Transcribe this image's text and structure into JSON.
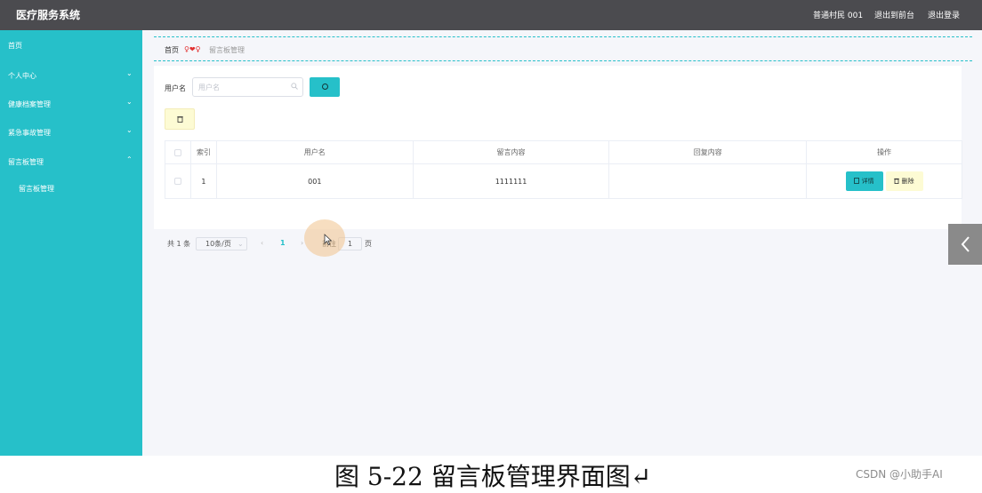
{
  "header": {
    "title": "医疗服务系统",
    "user_label": "普通村民 001",
    "back_label": "退出到前台",
    "logout_label": "退出登录"
  },
  "sidebar": {
    "items": [
      {
        "label": "首页",
        "chevron": ""
      },
      {
        "label": "个人中心",
        "chevron": "⌄"
      },
      {
        "label": "健康档案管理",
        "chevron": "⌄"
      },
      {
        "label": "紧急事故管理",
        "chevron": "⌄"
      },
      {
        "label": "留言板管理",
        "chevron": "⌃"
      },
      {
        "label": "留言板管理",
        "chevron": ""
      }
    ]
  },
  "breadcrumb": {
    "home": "首页",
    "separator": "♀❤♀",
    "current": "留言板管理"
  },
  "search": {
    "label": "用户名",
    "placeholder": "用户名",
    "value": ""
  },
  "table": {
    "headers": [
      "",
      "索引",
      "用户名",
      "留言内容",
      "回复内容",
      "操作"
    ],
    "rows": [
      {
        "index": "1",
        "username": "001",
        "content": "1111111",
        "reply": ""
      }
    ],
    "detail_label": "详情",
    "delete_label": "删除"
  },
  "pagination": {
    "total": "共 1 条",
    "page_size": "10条/页",
    "prev": "‹",
    "current_page": "1",
    "next": "›",
    "goto_label": "前往",
    "goto_value": "1",
    "page_unit": "页"
  },
  "caption": "图 5-22 留言板管理界面图↵",
  "watermark": "CSDN @小助手AI",
  "colors": {
    "accent": "#26c0c9",
    "header": "#4b4b4f",
    "warning_bg": "#fdfbd4"
  }
}
